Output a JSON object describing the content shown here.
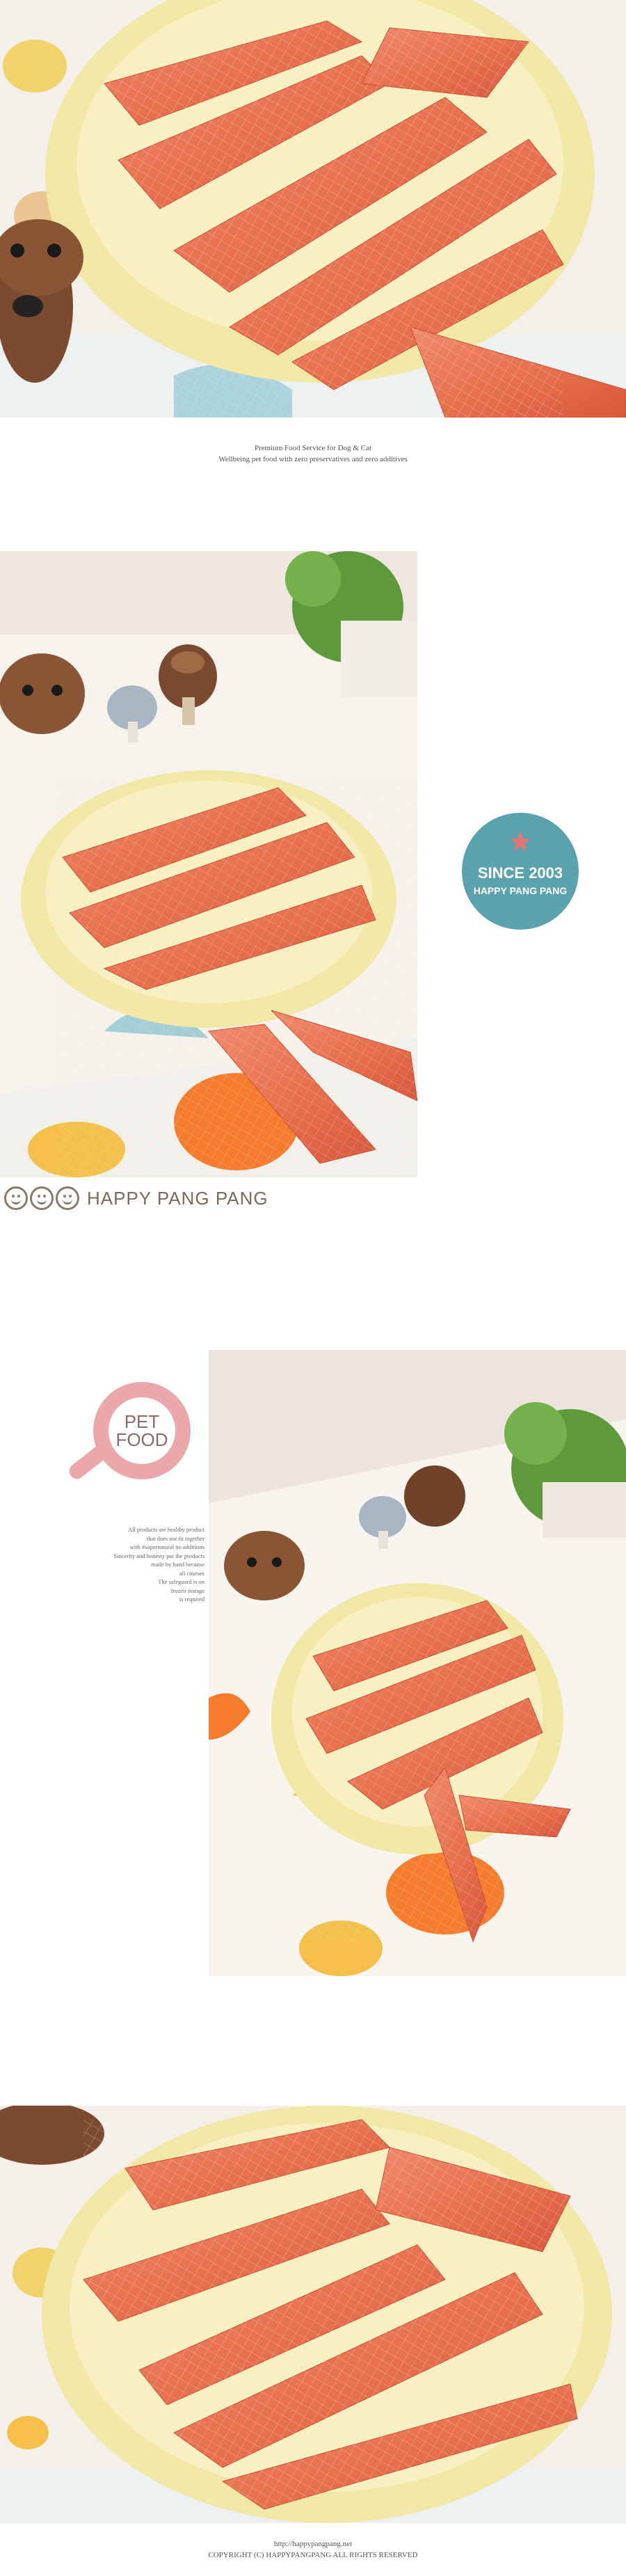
{
  "intro": {
    "line1": "Premium Food Service for Dog & Cat",
    "line2": "Wellbeing pet food with zero preservatives and zero additives"
  },
  "badge": {
    "line1": "SINCE 2003",
    "line2": "HAPPY PANG PANG",
    "colors": {
      "circle": "#5aa2ae",
      "star": "#e8746e"
    }
  },
  "brand": {
    "name": "HAPPY PANG PANG"
  },
  "pet_logo": {
    "line1": "PET",
    "line2": "FOOD",
    "color": "#eaa8aa"
  },
  "description": [
    "All products are healthy product",
    "that does not fit together",
    "with #supernatural no additions",
    "Sincerity and honesty put the products",
    "made by hand because",
    "all courses",
    "The safeguard is on",
    "frozen storage",
    "is required"
  ],
  "footer": {
    "url": "http://happypangpang.net",
    "copyright": "COPYRIGHT (C) HAPPYPANGPANG ALL RIGHTS RESERVED"
  }
}
